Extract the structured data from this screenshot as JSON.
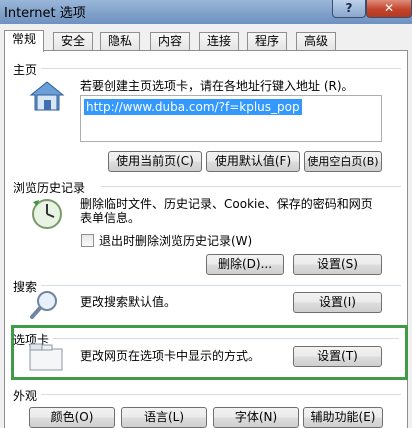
{
  "window": {
    "title": "Internet 选项",
    "help_label": "?",
    "close_label": "✕"
  },
  "tabs": [
    {
      "label": "常规",
      "active": true
    },
    {
      "label": "安全"
    },
    {
      "label": "隐私"
    },
    {
      "label": "内容"
    },
    {
      "label": "连接"
    },
    {
      "label": "程序"
    },
    {
      "label": "高级"
    }
  ],
  "homepage": {
    "title": "主页",
    "desc": "若要创建主页选项卡，请在各地址行键入地址 (R)。",
    "url": "http://www.duba.com/?f=kplus_pop",
    "use_current": "使用当前页(C)",
    "use_default": "使用默认值(F)",
    "use_blank": "使用空白页(B)"
  },
  "history": {
    "title": "浏览历史记录",
    "desc_line1": "删除临时文件、历史记录、Cookie、保存的密码和网页",
    "desc_line2": "表单信息。",
    "checkbox_label": "退出时删除浏览历史记录(W)",
    "delete_label": "删除(D)...",
    "settings_label": "设置(S)"
  },
  "search": {
    "title": "搜索",
    "desc": "更改搜索默认值。",
    "settings_label": "设置(I)"
  },
  "tabs_section": {
    "title": "选项卡",
    "desc": "更改网页在选项卡中显示的方式。",
    "settings_label": "设置(T)"
  },
  "appearance": {
    "title": "外观",
    "colors_label": "颜色(O)",
    "languages_label": "语言(L)",
    "fonts_label": "字体(N)",
    "accessibility_label": "辅助功能(E)"
  },
  "colors": {
    "highlight_border": "#3f9b48",
    "selection": "#3399ff",
    "close_button": "#c2442b"
  }
}
